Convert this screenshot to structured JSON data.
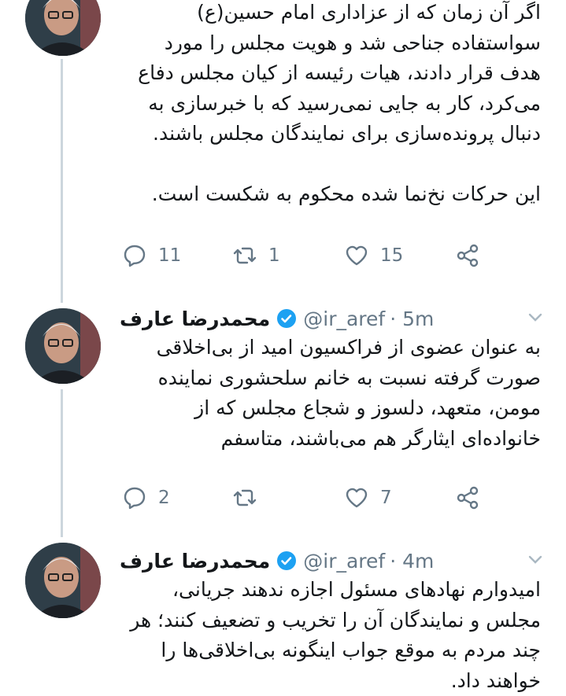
{
  "tweets": [
    {
      "text": "اگر آن زمان که از عزاداری امام حسین(ع)\nسواستفاده جناحی شد و هویت مجلس را مورد\nهدف قرار دادند، هیات رئیسه از کیان مجلس دفاع\nمی‌کرد، کار به جایی نمی‌رسید که با خبرسازی به\nدنبال پرونده‌سازی برای نمایندگان مجلس باشند.\n\nاین حرکات نخ‌نما شده محکوم به شکست است.",
      "replies": "11",
      "retweets": "1",
      "likes": "15"
    },
    {
      "name": "محمدرضا عارف",
      "handle": "@ir_aref",
      "time": "· 5m",
      "text": "به عنوان عضوی از فراکسیون امید از بی‌اخلاقی\nصورت گرفته نسبت به خانم سلحشوری نماینده\nمومن، متعهد، دلسوز و شجاع مجلس که از\nخانواده‌ای ایثارگر هم می‌باشند، متاسفم",
      "replies": "2",
      "retweets": "",
      "likes": "7"
    },
    {
      "name": "محمدرضا عارف",
      "handle": "@ir_aref",
      "time": "· 4m",
      "text": "امیدوارم نهادهای مسئول اجازه ندهند جریانی،\nمجلس و نمایندگان آن را تخریب و تضعیف کنند؛ هر\nچند مردم به موقع جواب اینگونه بی‌اخلاقی‌ها را\nخواهند داد."
    }
  ],
  "colors": {
    "verified": "#1da1f2",
    "muted": "#657786",
    "thread": "#ccd6dd"
  }
}
